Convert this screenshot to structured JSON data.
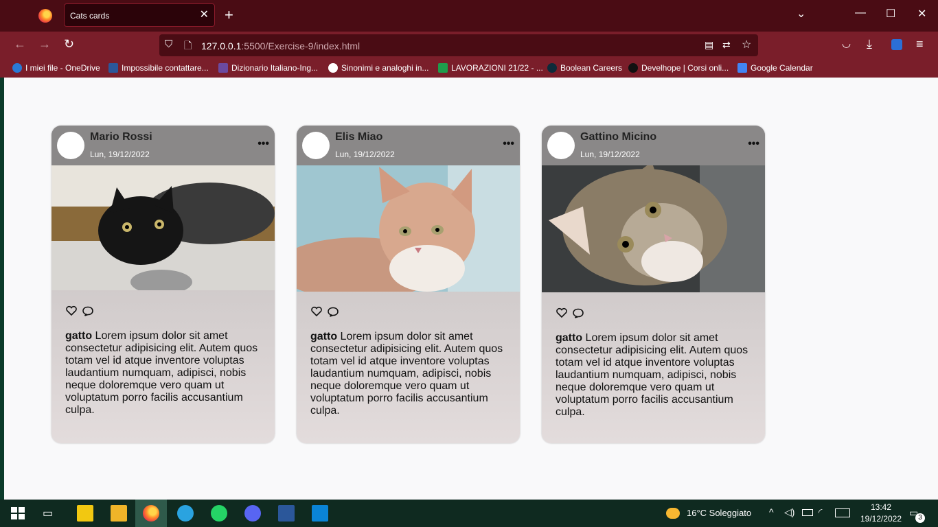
{
  "browser": {
    "tab_title": "Cats cards",
    "tab_close": "✕",
    "new_tab": "+",
    "url_host": "127.0.0.1",
    "url_rest": ":5500/Exercise-9/index.html",
    "bookmarks": [
      "I miei file - OneDrive",
      "Impossibile contattare...",
      "Dizionario Italiano-Ing...",
      "Sinonimi e analoghi in...",
      "LAVORAZIONI 21/22 - ...",
      "Boolean Careers",
      "Develhope | Corsi onli...",
      "Google Calendar"
    ]
  },
  "cards": [
    {
      "name": "Mario Rossi",
      "date": "Lun, 19/12/2022",
      "more": "•••",
      "bold": "gatto",
      "text": " Lorem ipsum dolor sit amet consectetur adipisicing elit. Autem quos totam vel id atque inventore voluptas laudantium numquam, adipisci, nobis neque doloremque vero quam ut voluptatum porro facilis accusantium culpa."
    },
    {
      "name": "Elis Miao",
      "date": "Lun, 19/12/2022",
      "more": "•••",
      "bold": "gatto",
      "text": " Lorem ipsum dolor sit amet consectetur adipisicing elit. Autem quos totam vel id atque inventore voluptas laudantium numquam, adipisci, nobis neque doloremque vero quam ut voluptatum porro facilis accusantium culpa."
    },
    {
      "name": "Gattino Micino",
      "date": "Lun, 19/12/2022",
      "more": "•••",
      "bold": "gatto",
      "text": " Lorem ipsum dolor sit amet consectetur adipisicing elit. Autem quos totam vel id atque inventore voluptas laudantium numquam, adipisci, nobis neque doloremque vero quam ut voluptatum porro facilis accusantium culpa."
    }
  ],
  "taskbar": {
    "weather": "16°C  Soleggiato",
    "time": "13:42",
    "date": "19/12/2022",
    "notifications": "3"
  },
  "colors": {
    "tabbar": "#4a0c14",
    "navbar": "#7a1e2a",
    "card_header": "#8a8888"
  }
}
